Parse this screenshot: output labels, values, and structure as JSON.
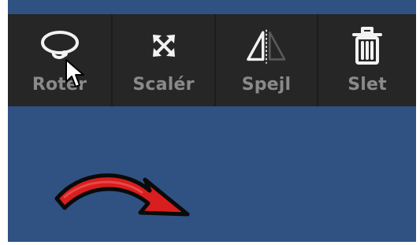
{
  "toolbar": {
    "tools": [
      {
        "label": "Rotér",
        "icon": "rotate-loop-icon"
      },
      {
        "label": "Scalér",
        "icon": "scale-arrows-icon"
      },
      {
        "label": "Spejl",
        "icon": "mirror-triangle-icon"
      },
      {
        "label": "Slet",
        "icon": "trash-icon"
      }
    ]
  },
  "canvas": {
    "sticker": "red-curved-arrow",
    "background_color": "#2f5282"
  },
  "colors": {
    "toolbar_bg": "#262626",
    "label_color": "#8a8a8a",
    "sticker_red": "#d81e1e"
  }
}
